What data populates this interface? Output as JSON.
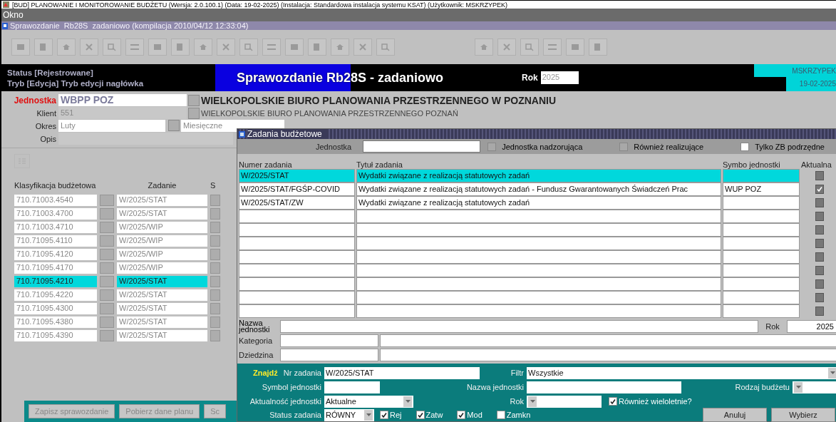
{
  "window": {
    "title": "[BUD] PLANOWANIE I MONITOROWANIE BUDŻETU (Wersja: 2.0.100.1) (Data: 19-02-2025) (Instalacja: Standardowa instalacja systemu KSAT) (Użytkownik: MSKRZYPEK)"
  },
  "menu": [
    "Okno"
  ],
  "form_window": {
    "title": "Sprawozdanie  Rb28S  zadaniowo (kompilacja 2010/04/12 12:33:04)"
  },
  "header": {
    "status": "Status [Rejestrowane]",
    "mode": "Tryb [Edycja] Tryb edycji nagłówka",
    "title": "Sprawozdanie Rb28S - zadaniowo",
    "year_label": "Rok",
    "year": "2025",
    "user": "MSKRZYPEK",
    "date": "19-02-2025"
  },
  "form": {
    "unit_label": "Jednostka",
    "unit": "WBPP POZ",
    "unit_name": "WIELKOPOLSKIE BIURO PLANOWANIA PRZESTRZENNEGO W POZNANIU",
    "client_label": "Klient",
    "client": "551",
    "client_name": "WIELKOPOLSKIE BIURO PLANOWANIA PRZESTRZENNEGO POZNAŃ",
    "period_label": "Okres",
    "period": "Luty",
    "period_type": "Miesięczne",
    "desc_label": "Opis"
  },
  "lines": {
    "columns": [
      "Klasyfikacja budżetowa",
      "Zadanie",
      "S"
    ],
    "rows": [
      {
        "classification": "710.71003.4540",
        "task": "W/2025/STAT",
        "selected": false
      },
      {
        "classification": "710.71003.4700",
        "task": "W/2025/STAT",
        "selected": false
      },
      {
        "classification": "710.71003.4710",
        "task": "W/2025/WIP",
        "selected": false
      },
      {
        "classification": "710.71095.4110",
        "task": "W/2025/WIP",
        "selected": false
      },
      {
        "classification": "710.71095.4120",
        "task": "W/2025/WIP",
        "selected": false
      },
      {
        "classification": "710.71095.4170",
        "task": "W/2025/WIP",
        "selected": false
      },
      {
        "classification": "710.71095.4210",
        "task": "W/2025/STAT",
        "selected": true
      },
      {
        "classification": "710.71095.4220",
        "task": "W/2025/STAT",
        "selected": false
      },
      {
        "classification": "710.71095.4300",
        "task": "W/2025/STAT",
        "selected": false
      },
      {
        "classification": "710.71095.4380",
        "task": "W/2025/STAT",
        "selected": false
      },
      {
        "classification": "710.71095.4390",
        "task": "W/2025/STAT",
        "selected": false
      }
    ]
  },
  "bottom_buttons": [
    "Zapisz sprawozdanie",
    "Pobierz dane planu",
    "Sc"
  ],
  "dialog": {
    "title": "Zadania budżetowe",
    "filter": {
      "unit_label": "Jednostka",
      "options": [
        {
          "label": "Jednostka nadzorująca",
          "checked": false,
          "disabled": true
        },
        {
          "label": "Również realizujące",
          "checked": false,
          "disabled": true
        },
        {
          "label": "Tylko ZB podrzędne",
          "checked": false,
          "disabled": false
        }
      ]
    },
    "columns": [
      "Numer zadania",
      "Tytuł zadania",
      "Symbo jednostki",
      "Aktualna"
    ],
    "rows": [
      {
        "number": "W/2025/STAT",
        "title": "Wydatki związane z realizacją statutowych zadań",
        "unit": "",
        "current": false,
        "selected": true
      },
      {
        "number": "W/2025/STAT/FGŚP-COVID",
        "title": "Wydatki związane z realizacją statutowych zadań - Fundusz Gwarantowanych Świadczeń Prac",
        "unit": "WUP POZ",
        "current": true,
        "selected": false
      },
      {
        "number": "W/2025/STAT/ZW",
        "title": "Wydatki związane z realizacją statutowych zadań",
        "unit": "",
        "current": false,
        "selected": false
      },
      {
        "current": false,
        "selected": false
      },
      {
        "current": false,
        "selected": false
      },
      {
        "current": false,
        "selected": false
      },
      {
        "current": false,
        "selected": false
      },
      {
        "current": false,
        "selected": false
      },
      {
        "current": false,
        "selected": false
      },
      {
        "current": false,
        "selected": false
      },
      {
        "current": false,
        "selected": false
      }
    ],
    "details": {
      "unit_name_label": "Nazwa jednostki",
      "year_label": "Rok",
      "year": "2025",
      "category_label": "Kategoria",
      "domain_label": "Dziedzina"
    },
    "search": {
      "title": "Znajdź",
      "task_no_label": "Nr zadania",
      "task_no": "W/2025/STAT",
      "filter_label": "Filtr",
      "filter": "Wszystkie",
      "unit_symbol_label": "Symbol jednostki",
      "unit_name_label": "Nazwa jednostki",
      "budget_type_label": "Rodzaj budżetu",
      "unit_current_label": "Aktualność jednostki",
      "unit_current": "Aktualne",
      "year_label": "Rok",
      "multiyear": {
        "label": "Również wieloletnie?",
        "checked": true
      },
      "status_label": "Status zadania",
      "status": "RÓWNY",
      "statuses": [
        {
          "label": "Rej",
          "checked": true
        },
        {
          "label": "Zatw",
          "checked": true
        },
        {
          "label": "Mod",
          "checked": true
        },
        {
          "label": "Zamkn",
          "checked": false
        }
      ]
    },
    "buttons": [
      "Anuluj",
      "Wybierz"
    ]
  }
}
